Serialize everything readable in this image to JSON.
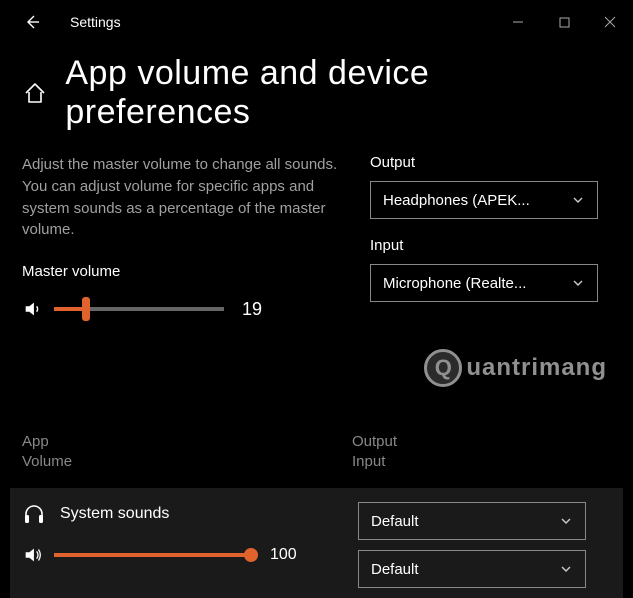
{
  "titlebar": {
    "title": "Settings"
  },
  "page": {
    "heading": "App volume and device preferences",
    "description": "Adjust the master volume to change all sounds. You can adjust volume for specific apps and system sounds as a percentage of the master volume."
  },
  "master": {
    "label": "Master volume",
    "value": "19",
    "percent": 19
  },
  "output": {
    "label": "Output",
    "selected": "Headphones (APEK..."
  },
  "input": {
    "label": "Input",
    "selected": "Microphone (Realte..."
  },
  "watermark": {
    "text": "uantrimang"
  },
  "columns": {
    "app": "App",
    "volume": "Volume",
    "output": "Output",
    "input": "Input"
  },
  "apps": {
    "system_sounds": {
      "name": "System sounds",
      "volume": "100",
      "output": "Default",
      "input": "Default"
    }
  }
}
